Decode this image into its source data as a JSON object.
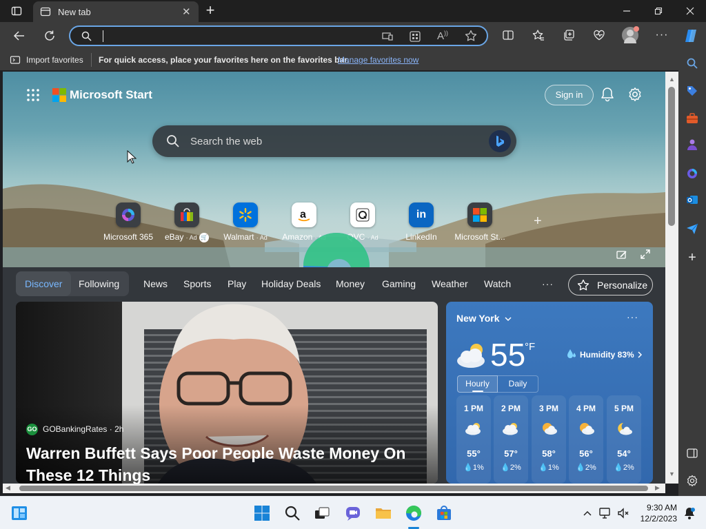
{
  "browser": {
    "tab_title": "New tab",
    "address_value": "",
    "favorites_import": "Import favorites",
    "favorites_hint": "For quick access, place your favorites here on the favorites bar.",
    "favorites_manage": "Manage favorites now"
  },
  "start": {
    "brand": "Microsoft Start",
    "sign_in": "Sign in",
    "search_placeholder": "Search the web",
    "quick_links": [
      {
        "label": "Microsoft 365",
        "icon": "microsoft-365-icon"
      },
      {
        "label": "eBay",
        "ad": "· Ad",
        "icon": "ebay-icon"
      },
      {
        "label": "Walmart",
        "ad": "· Ad",
        "icon": "walmart-icon"
      },
      {
        "label": "Amazon",
        "ad": "· Ad",
        "icon": "amazon-icon"
      },
      {
        "label": "QVC",
        "ad": "· Ad",
        "icon": "qvc-icon"
      },
      {
        "label": "LinkedIn",
        "icon": "linkedin-icon"
      },
      {
        "label": "Microsoft St...",
        "icon": "microsoft-store-icon"
      }
    ],
    "tabs": {
      "discover": "Discover",
      "following": "Following",
      "more": "···",
      "personalize": "Personalize",
      "items": [
        "News",
        "Sports",
        "Play",
        "Holiday Deals",
        "Money",
        "Gaming",
        "Weather",
        "Watch"
      ]
    },
    "article": {
      "source_logo": "GO",
      "source": "GOBankingRates",
      "age": "· 2h",
      "headline_line1": "Warren Buffett Says Poor People Waste Money On",
      "headline_line2": "These 12 Things"
    },
    "weather": {
      "city": "New York",
      "temp": "55",
      "unit": "°F",
      "humidity": "Humidity 83%",
      "mode_hourly": "Hourly",
      "mode_daily": "Daily",
      "hours": [
        {
          "time": "1 PM",
          "temp": "55°",
          "precip": "1%",
          "icon": "cloudy-icon"
        },
        {
          "time": "2 PM",
          "temp": "57°",
          "precip": "2%",
          "icon": "cloudy-icon"
        },
        {
          "time": "3 PM",
          "temp": "58°",
          "precip": "1%",
          "icon": "partly-sunny-icon"
        },
        {
          "time": "4 PM",
          "temp": "56°",
          "precip": "2%",
          "icon": "partly-sunny-icon"
        },
        {
          "time": "5 PM",
          "temp": "54°",
          "precip": "2%",
          "icon": "partly-cloudy-night-icon"
        }
      ]
    }
  },
  "taskbar": {
    "time": "9:30 AM",
    "date": "12/2/2023"
  },
  "colors": {
    "accent": "#6aa6e6",
    "link": "#8ab4f8",
    "weather_card": "#3a73b9"
  }
}
